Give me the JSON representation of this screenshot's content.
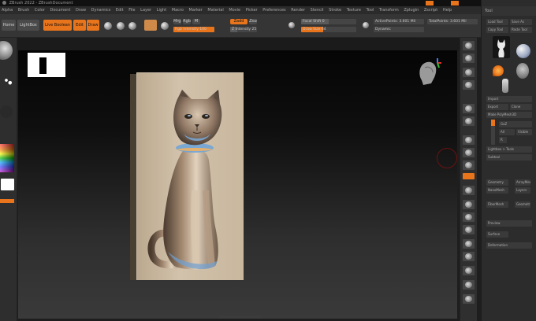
{
  "app": {
    "title": "ZBrush 2022 - ZBrushDocument",
    "accent_color": "#e8741c",
    "background_color": "#1e1e1e"
  },
  "menubar": {
    "items": [
      "Alpha",
      "Brush",
      "Color",
      "Document",
      "Draw",
      "Dynamics",
      "Edit",
      "File",
      "Layer",
      "Light",
      "Macro",
      "Marker",
      "Material",
      "Movie",
      "Picker",
      "Preferences",
      "Render",
      "Stencil",
      "Stroke",
      "Texture",
      "Tool",
      "Transform",
      "Zplugin",
      "Zscript",
      "Help"
    ]
  },
  "toolbar": {
    "home_label": "Home",
    "lightbox_label": "LightBox",
    "live_boolean_label": "Live Boolean",
    "edit_label": "Edit",
    "draw_label": "Draw",
    "mrgb_label": "Mrgb",
    "rgb_label": "Rgb",
    "m_label": "M",
    "zadd_label": "Zadd",
    "zsub_label": "Zsub",
    "focal_shift_label": "Focal Shift 0",
    "draw_size_label": "Draw Size 64",
    "dynamic_label": "Dynamic",
    "rgb_intensity_label": "Rgb Intensity 100",
    "z_intensity_label": "Z Intensity 25",
    "active_points_label": "ActivePoints: 3.601 Mil",
    "total_points_label": "TotalPoints: 3.601 Mil"
  },
  "left_shelf": {
    "icons": [
      "brush-icon",
      "stroke-icon",
      "alpha-icon",
      "material-icon",
      "color-picker-icon"
    ],
    "swatch_color": "#ffffff"
  },
  "canvas": {
    "document_thumbnail": "document-thumbnail",
    "model": "cat-relief-model",
    "navigation_gizmo": "head-navigation-gizmo"
  },
  "right_shelf": {
    "buttons": [
      "bpr-icon",
      "spix-icon",
      "scroll-icon",
      "zoom-icon",
      "actual-icon",
      "aahalf-icon",
      "persp-icon",
      "floor-icon",
      "local-icon",
      "xyz-icon",
      "frame-icon",
      "move-icon",
      "scale-icon",
      "rotate-icon",
      "polyf-icon",
      "transp-icon",
      "ghost-icon",
      "solo-icon",
      "xpose-icon"
    ]
  },
  "tray": {
    "header": "Tool",
    "rows": [
      "Load Tool",
      "Save As",
      "Copy Tool",
      "Paste Tool",
      "Import",
      "Export",
      "Clone",
      "Make PolyMesh3D",
      "GoZ",
      "All",
      "Visible",
      "R",
      "Lightbox > Tools",
      "Subtool",
      "Geometry",
      "ArrayMesh",
      "NanoMesh",
      "Layers",
      "FiberMesh",
      "Geometry HD",
      "Preview",
      "Surface",
      "Deformation"
    ]
  }
}
